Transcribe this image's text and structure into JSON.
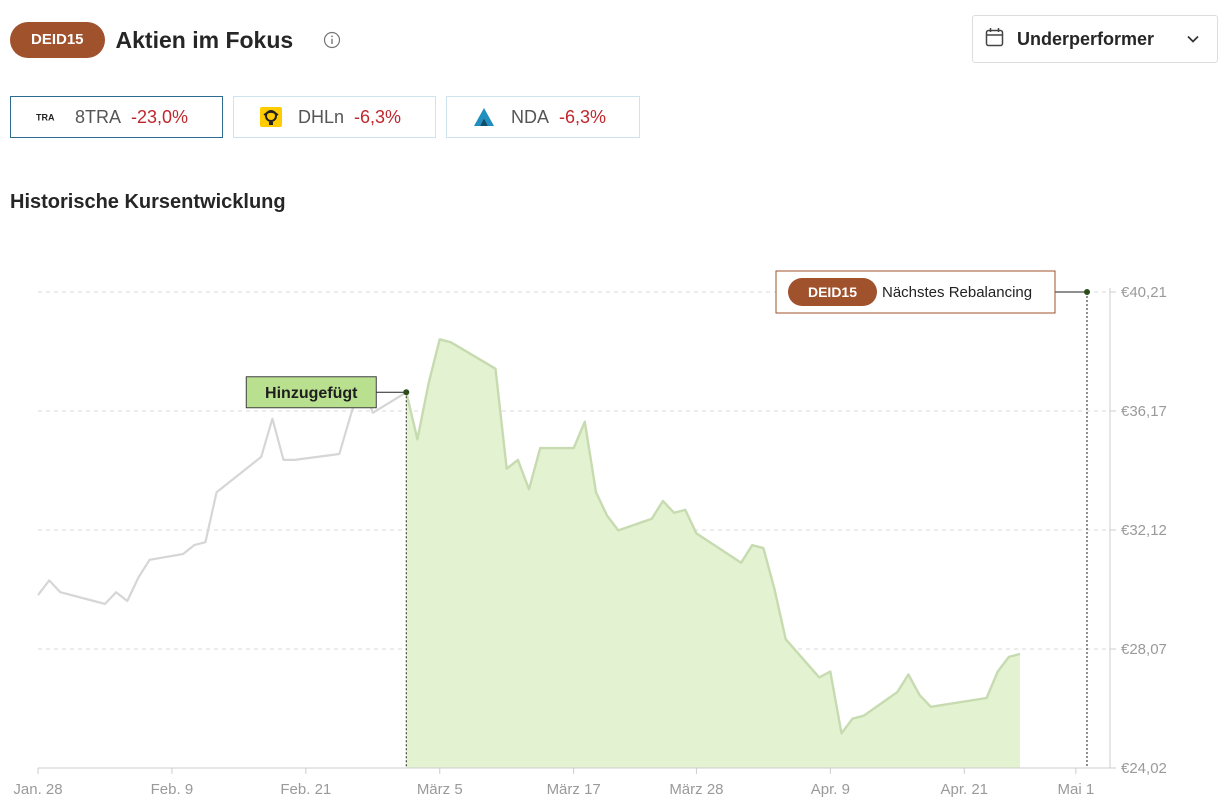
{
  "header": {
    "badge": "DEID15",
    "title": "Aktien im Fokus",
    "info_icon": "info-circle-icon"
  },
  "filter": {
    "selected": "Underperformer",
    "icon": "calendar-icon",
    "chevron": "chevron-down-icon"
  },
  "stocks": [
    {
      "ticker": "8TRA",
      "change": "-23,0%",
      "logo_text": "TRA"
    },
    {
      "ticker": "DHLn",
      "change": "-6,3%"
    },
    {
      "ticker": "NDA",
      "change": "-6,3%"
    }
  ],
  "section_title": "Historische Kursentwicklung",
  "colors": {
    "accent": "#a0522d",
    "negative": "#c0272d",
    "area_fill": "#e3f2d0",
    "line_active": "#c7dbb1",
    "line_history": "#d6d6d6",
    "added_label_bg": "#b9e08f"
  },
  "chart_data": {
    "type": "area",
    "currency": "€",
    "ylim": [
      24.02,
      40.21
    ],
    "y_ticks": [
      "€40,21",
      "€36,17",
      "€32,12",
      "€28,07",
      "€24,02"
    ],
    "x_ticks": [
      "Jan. 28",
      "Feb. 9",
      "Feb. 21",
      "März 5",
      "März 17",
      "März 28",
      "Apr. 9",
      "Apr. 21",
      "Mai 1"
    ],
    "x_range": [
      "2025-01-28",
      "2025-05-02"
    ],
    "added_date": "2025-03-02",
    "rebalancing_date": "2025-05-02",
    "annotations": {
      "added": "Hinzugefügt",
      "rebalancing_badge": "DEID15",
      "rebalancing": "Nächstes Rebalancing"
    },
    "series": [
      {
        "values": [
          [
            "2025-01-28",
            29.9
          ],
          [
            "2025-01-29",
            30.4
          ],
          [
            "2025-01-30",
            30.0
          ],
          [
            "2025-02-02",
            29.7
          ],
          [
            "2025-02-03",
            29.6
          ],
          [
            "2025-02-04",
            30.0
          ],
          [
            "2025-02-05",
            29.7
          ],
          [
            "2025-02-06",
            30.5
          ],
          [
            "2025-02-07",
            31.1
          ],
          [
            "2025-02-10",
            31.3
          ],
          [
            "2025-02-11",
            31.6
          ],
          [
            "2025-02-12",
            31.7
          ],
          [
            "2025-02-13",
            33.4
          ],
          [
            "2025-02-17",
            34.6
          ],
          [
            "2025-02-18",
            35.9
          ],
          [
            "2025-02-19",
            34.5
          ],
          [
            "2025-02-20",
            34.5
          ],
          [
            "2025-02-24",
            34.7
          ],
          [
            "2025-02-25",
            36.0
          ],
          [
            "2025-02-26",
            37.2
          ],
          [
            "2025-02-27",
            36.1
          ],
          [
            "2025-03-02",
            36.8
          ],
          [
            "2025-03-03",
            35.2
          ],
          [
            "2025-03-04",
            37.1
          ],
          [
            "2025-03-05",
            38.6
          ],
          [
            "2025-03-06",
            38.5
          ],
          [
            "2025-03-10",
            37.6
          ],
          [
            "2025-03-11",
            34.2
          ],
          [
            "2025-03-12",
            34.5
          ],
          [
            "2025-03-13",
            33.5
          ],
          [
            "2025-03-14",
            34.9
          ],
          [
            "2025-03-17",
            34.9
          ],
          [
            "2025-03-18",
            35.8
          ],
          [
            "2025-03-19",
            33.4
          ],
          [
            "2025-03-20",
            32.6
          ],
          [
            "2025-03-21",
            32.1
          ],
          [
            "2025-03-24",
            32.5
          ],
          [
            "2025-03-25",
            33.1
          ],
          [
            "2025-03-26",
            32.7
          ],
          [
            "2025-03-27",
            32.8
          ],
          [
            "2025-03-28",
            32.0
          ],
          [
            "2025-04-01",
            31.0
          ],
          [
            "2025-04-02",
            31.6
          ],
          [
            "2025-04-03",
            31.5
          ],
          [
            "2025-04-04",
            30.1
          ],
          [
            "2025-04-05",
            28.4
          ],
          [
            "2025-04-08",
            27.1
          ],
          [
            "2025-04-09",
            27.3
          ],
          [
            "2025-04-10",
            25.2
          ],
          [
            "2025-04-11",
            25.7
          ],
          [
            "2025-04-12",
            25.8
          ],
          [
            "2025-04-15",
            26.6
          ],
          [
            "2025-04-16",
            27.2
          ],
          [
            "2025-04-17",
            26.5
          ],
          [
            "2025-04-18",
            26.1
          ],
          [
            "2025-04-23",
            26.4
          ],
          [
            "2025-04-24",
            27.3
          ],
          [
            "2025-04-25",
            27.8
          ],
          [
            "2025-04-26",
            27.9
          ]
        ]
      }
    ]
  }
}
